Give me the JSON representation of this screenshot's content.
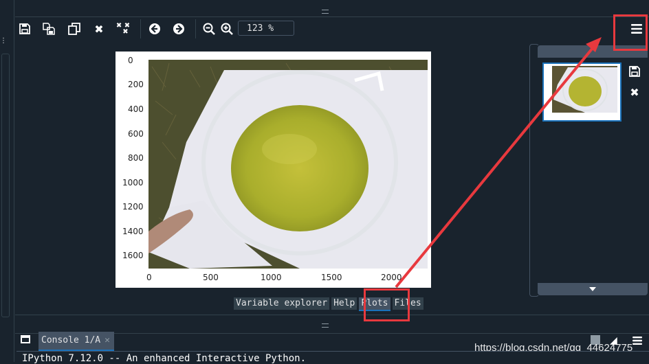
{
  "toolbar": {
    "buttons": [
      {
        "name": "save-plot",
        "icon": "save-icon"
      },
      {
        "name": "save-all-plots",
        "icon": "save-all-icon"
      },
      {
        "name": "copy-plot",
        "icon": "copy-icon"
      },
      {
        "name": "remove-plot",
        "icon": "close-icon"
      },
      {
        "name": "remove-all-plots",
        "icon": "close-all-icon"
      },
      {
        "name": "previous-plot",
        "icon": "arrow-left-icon"
      },
      {
        "name": "next-plot",
        "icon": "arrow-right-icon"
      },
      {
        "name": "zoom-out",
        "icon": "zoom-out-icon"
      },
      {
        "name": "zoom-in",
        "icon": "zoom-in-icon"
      }
    ],
    "zoom_value": "123 %",
    "options_icon": "hamburger-menu-icon"
  },
  "plot": {
    "y_ticks": [
      "0",
      "200",
      "400",
      "600",
      "800",
      "1000",
      "1200",
      "1400",
      "1600"
    ],
    "x_ticks": [
      "0",
      "500",
      "1000",
      "1500",
      "2000"
    ],
    "image_subject": "beaker with yellow liquid on paper over grass"
  },
  "tabs": [
    {
      "label": "Variable explorer",
      "active": false
    },
    {
      "label": "Help",
      "active": false
    },
    {
      "label": "Plots",
      "active": true
    },
    {
      "label": "Files",
      "active": false
    }
  ],
  "console": {
    "tab_label": "Console 1/A",
    "first_line": "IPython 7.12.0 -- An enhanced Interactive Python."
  },
  "watermark": "https://blog.csdn.net/qq_44624775",
  "colors": {
    "background": "#19232d",
    "accent": "#1a72bb",
    "annotation": "#e8393e"
  }
}
